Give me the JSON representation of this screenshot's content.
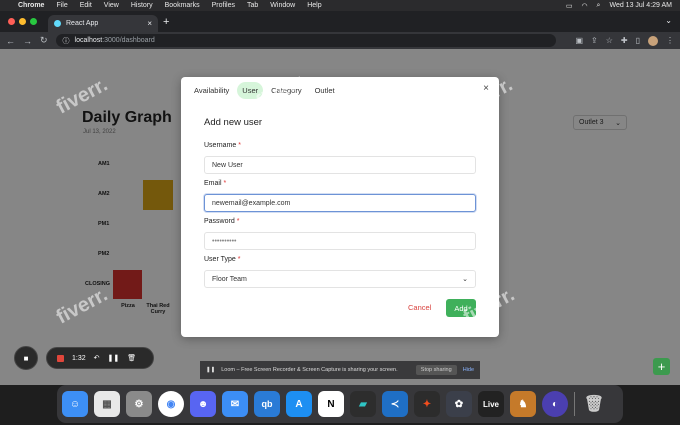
{
  "menubar": {
    "app": "Chrome",
    "items": [
      "File",
      "Edit",
      "View",
      "History",
      "Bookmarks",
      "Profiles",
      "Tab",
      "Window",
      "Help"
    ],
    "datetime": "Wed 13 Jul  4:29 AM"
  },
  "browser": {
    "tab_title": "React App",
    "url_host": "localhost",
    "url_path": ":3000/dashboard"
  },
  "page": {
    "title": "Daily Graph",
    "date": "Jul 13, 2022",
    "outlet_select": "Outlet 3",
    "y_labels": [
      "AM1",
      "AM2",
      "PM1",
      "PM2",
      "CLOSING"
    ],
    "x_labels": [
      "Pizza",
      "Thai Red\nCurry"
    ],
    "fab_label": "+"
  },
  "modal": {
    "tabs": [
      "Availability",
      "User",
      "Category",
      "Outlet"
    ],
    "active_tab": "User",
    "title": "Add new user",
    "fields": {
      "username_label": "Username",
      "username_value": "New User",
      "email_label": "Email",
      "email_value": "newemail@example.com",
      "password_label": "Password",
      "password_value": "••••••••••",
      "usertype_label": "User Type",
      "usertype_value": "Floor Team"
    },
    "required_mark": "*",
    "cancel_label": "Cancel",
    "add_label": "Add",
    "close_glyph": "×"
  },
  "recorder": {
    "time": "1:32"
  },
  "sharebar": {
    "message": "Loom – Free Screen Recorder & Screen Capture is sharing your screen.",
    "stop_label": "Stop sharing",
    "hide_label": "Hide"
  },
  "watermark": "fiverr.",
  "colors": {
    "amber": "#d4a017",
    "red": "#d0312d",
    "green": "#3fb05b"
  }
}
